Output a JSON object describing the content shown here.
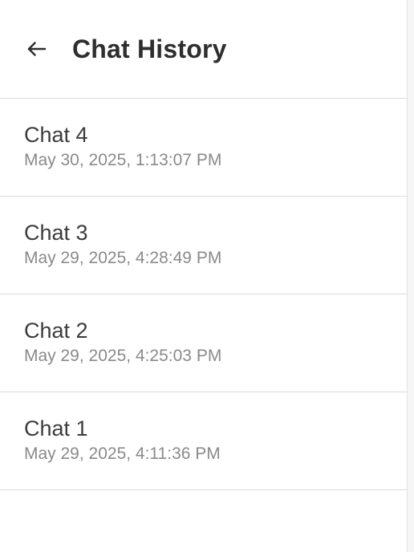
{
  "header": {
    "title": "Chat History",
    "back_icon": "arrow-left-icon"
  },
  "chats": [
    {
      "name": "Chat 4",
      "timestamp": "May 30, 2025, 1:13:07 PM"
    },
    {
      "name": "Chat 3",
      "timestamp": "May 29, 2025, 4:28:49 PM"
    },
    {
      "name": "Chat 2",
      "timestamp": "May 29, 2025, 4:25:03 PM"
    },
    {
      "name": "Chat 1",
      "timestamp": "May 29, 2025, 4:11:36 PM"
    }
  ],
  "colors": {
    "title": "#2e2e2e",
    "chat_name": "#3c3c3c",
    "timestamp": "#8a8a8a",
    "divider": "#dcdcdc"
  }
}
